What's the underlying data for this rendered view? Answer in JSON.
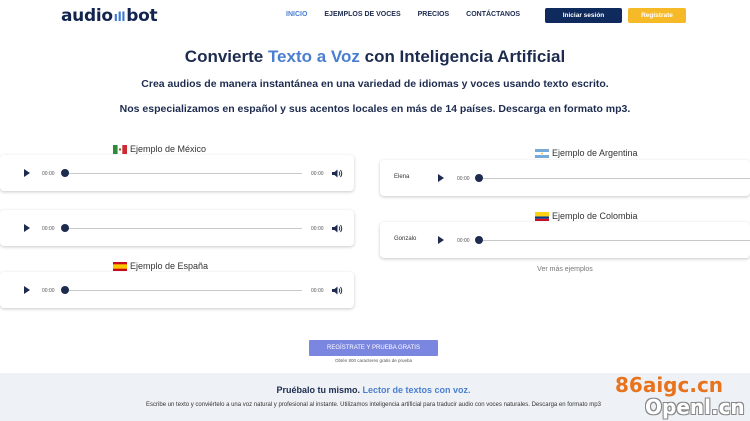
{
  "header": {
    "logo_left": "audio",
    "logo_right": "bot",
    "nav": [
      {
        "label": "INICIO",
        "active": true
      },
      {
        "label": "EJEMPLOS DE VOCES",
        "active": false
      },
      {
        "label": "PRECIOS",
        "active": false
      },
      {
        "label": "CONTÁCTANOS",
        "active": false
      }
    ],
    "login_label": "Iniciar sesión",
    "register_label": "Registrate"
  },
  "hero": {
    "title_pre": "Convierte ",
    "title_highlight": "Texto a Voz",
    "title_post": " con Inteligencia Artificial",
    "line1": "Crea audios de manera instantánea en una variedad de idiomas y voces usando texto escrito.",
    "line2": "Nos especializamos en español y sus acentos locales en más de 14 países. Descarga en formato mp3."
  },
  "samples": {
    "mexico_title": "Ejemplo de México",
    "espana_title": "Ejemplo de España",
    "argentina_title": "Ejemplo de Argentina",
    "colombia_title": "Ejemplo de Colombia",
    "argentina_voice": "Elena",
    "colombia_voice": "Gonzalo",
    "time_current": "00:00",
    "time_total": "00:00",
    "more_label": "Ver más ejemplos"
  },
  "cta": {
    "label": "REGÍSTRATE Y PRUEBA GRATIS",
    "note": "Obtén 800 caracteres gratis de prueba"
  },
  "footer": {
    "title_pre": "Pruébalo tu mismo. ",
    "title_highlight": "Lector de textos con voz.",
    "text": "Escribe un texto y conviértelo a una voz natural y profesional al instante. Utilizamos inteligencia artificial para traducir audio con voces naturales. Descarga en formato mp3"
  },
  "watermark": {
    "line1": "86aigc.cn",
    "line2": "Openl.cn"
  },
  "colors": {
    "navy": "#0f2a5c",
    "accent_blue": "#4a7fd0",
    "yellow": "#f6b928",
    "cta": "#7b86e0"
  }
}
